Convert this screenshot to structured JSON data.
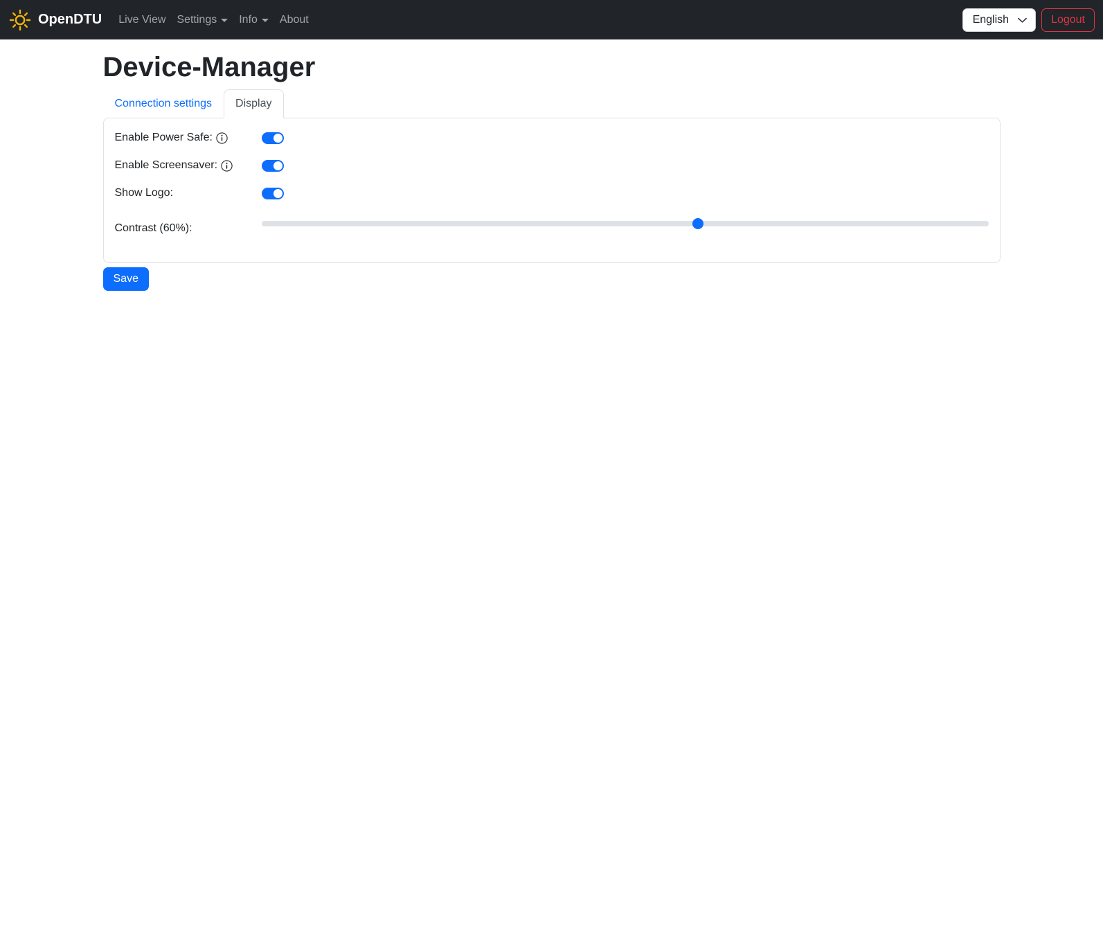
{
  "navbar": {
    "brand": "OpenDTU",
    "items": [
      {
        "label": "Live View",
        "has_dropdown": false
      },
      {
        "label": "Settings",
        "has_dropdown": true
      },
      {
        "label": "Info",
        "has_dropdown": true
      },
      {
        "label": "About",
        "has_dropdown": false
      }
    ],
    "language_selected": "English",
    "logout_label": "Logout"
  },
  "page": {
    "title": "Device-Manager",
    "tabs": [
      {
        "label": "Connection settings",
        "active": false
      },
      {
        "label": "Display",
        "active": true
      }
    ]
  },
  "settings": {
    "rows": [
      {
        "label": "Enable Power Safe:",
        "has_info": true,
        "control": "toggle",
        "value": true
      },
      {
        "label": "Enable Screensaver:",
        "has_info": true,
        "control": "toggle",
        "value": true
      },
      {
        "label": "Show Logo:",
        "has_info": false,
        "control": "toggle",
        "value": true
      },
      {
        "label": "Contrast (60%):",
        "has_info": false,
        "control": "slider",
        "value_percent": 60
      }
    ],
    "save_label": "Save"
  },
  "colors": {
    "navbar_bg": "#212529",
    "primary": "#0d6efd",
    "danger": "#dc3545",
    "brand_icon": "#f5b301",
    "border": "#dee2e6",
    "inactive_tab_link": "#0d6efd",
    "active_tab_text": "#495057"
  }
}
